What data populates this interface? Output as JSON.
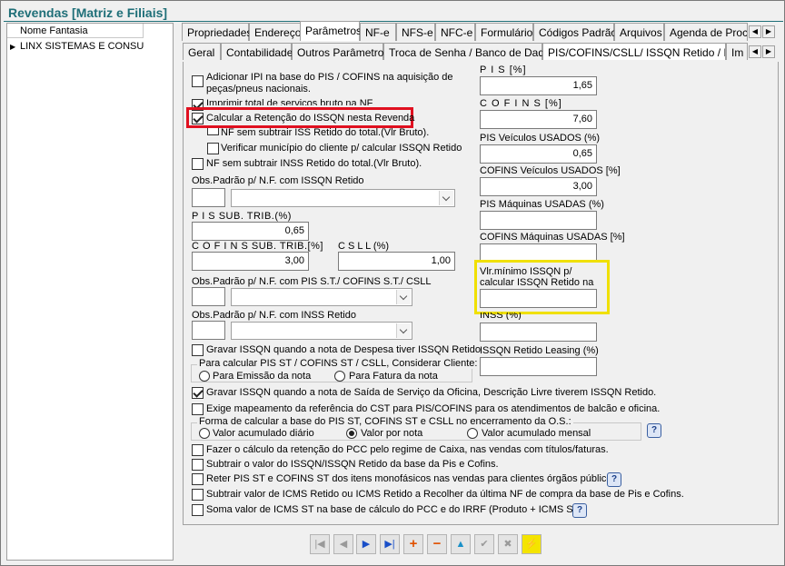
{
  "window": {
    "title": "Revendas [Matriz e Filiais]"
  },
  "left_grid": {
    "header": "Nome Fantasia",
    "rows": [
      "LINX SISTEMAS E CONSULT"
    ]
  },
  "tabs_main": [
    "Propriedades",
    "Endereço",
    "Parâmetros",
    "NF-e",
    "NFS-e",
    "NFC-e",
    "Formulários",
    "Códigos Padrão",
    "Arquivos",
    "Agenda de Proces"
  ],
  "tabs_main_selected": "Parâmetros",
  "tabs_sub": [
    "Geral",
    "Contabilidade",
    "Outros Parâmetros",
    "Troca de Senha / Banco de Dados",
    "PIS/COFINS/CSLL/ ISSQN Retido / INSS",
    "Im"
  ],
  "tabs_sub_selected": "PIS/COFINS/CSLL/ ISSQN Retido / INSS",
  "options": {
    "ipi": "Adicionar IPI na base do PIS / COFINS na aquisição de peças/pneus nacionais.",
    "imprimir": "Imprimir total de serviços bruto na NF",
    "calc_issqn": "Calcular a Retenção do ISSQN nesta Revenda",
    "nf_sem_iss": "NF sem subtrair ISS Retido do total.(Vlr Bruto).",
    "verif_municipio": "Verificar município do cliente p/ calcular ISSQN Retido",
    "nf_sem_inss": "NF sem subtrair INSS Retido do total.(Vlr Bruto).",
    "gravar_despesa": "Gravar ISSQN quando a nota de Despesa tiver ISSQN Retido",
    "gravar_saida": "Gravar ISSQN quando a nota de Saída de Serviço da Oficina, Descrição Livre tiverem ISSQN Retido.",
    "exige_map": "Exige mapeamento da referência do CST para PIS/COFINS para os atendimentos de balcão e oficina.",
    "pcc": "Fazer o cálculo da retenção do PCC pelo regime de Caixa, nas vendas com títulos/faturas.",
    "subtrair_issqn": "Subtrair o valor do ISSQN/ISSQN Retido da base da Pis e Cofins.",
    "reter_pis": "Reter PIS ST e COFINS ST dos itens monofásicos nas vendas para clientes órgãos públicos.",
    "subtrair_icms": "Subtrair valor de ICMS Retido ou ICMS Retido a Recolher da última NF de compra da base de Pis e Cofins.",
    "soma_icms": "Soma valor de ICMS ST na base de cálculo do PCC e do IRRF (Produto + ICMS ST)"
  },
  "labels": {
    "obs_issqn": "Obs.Padrão p/ N.F. com ISSQN Retido",
    "pis_sub": "P I S  SUB. TRIB.(%)",
    "cofins_sub": "C O F I N S  SUB. TRIB.[%]",
    "csll": "C S L L  (%)",
    "obs_pis_st": "Obs.Padrão p/ N.F. com PIS S.T./ COFINS S.T./ CSLL",
    "obs_inss": "Obs.Padrão p/ N.F. com INSS Retido",
    "pis": "P I S  [%]",
    "cofins": "C O F I N S  [%]",
    "pis_veic": "PIS Veículos  USADOS (%)",
    "cofins_veic": "COFINS Veículos  USADOS [%]",
    "pis_maq": "PIS Máquinas  USADAS (%)",
    "cofins_maq": "COFINS Máquinas USADAS [%]",
    "vlr_min": "Vlr.mínimo ISSQN p/ calcular ISSQN Retido na nota fiscal.",
    "inss": "INSS (%)",
    "issqn_leasing": "ISSQN Retido Leasing (%)"
  },
  "values": {
    "pis_sub": "0,65",
    "cofins_sub": "3,00",
    "csll": "1,00",
    "pis": "1,65",
    "cofins": "7,60",
    "pis_veic": "0,65",
    "cofins_veic": "3,00"
  },
  "group_cliente": {
    "title": "Para calcular PIS ST / COFINS ST / CSLL, Considerar Cliente:",
    "opt1": "Para Emissão da nota",
    "opt2": "Para Fatura da nota"
  },
  "group_os": {
    "title": "Forma de calcular a base do PIS ST, COFINS ST e CSLL no encerramento da O.S.:",
    "opt1": "Valor acumulado diário",
    "opt2": "Valor por nota",
    "opt3": "Valor acumulado mensal"
  },
  "colors": {
    "title": "#1f6f78",
    "red_highlight": "#e01020",
    "yellow_highlight": "#f0e000"
  }
}
